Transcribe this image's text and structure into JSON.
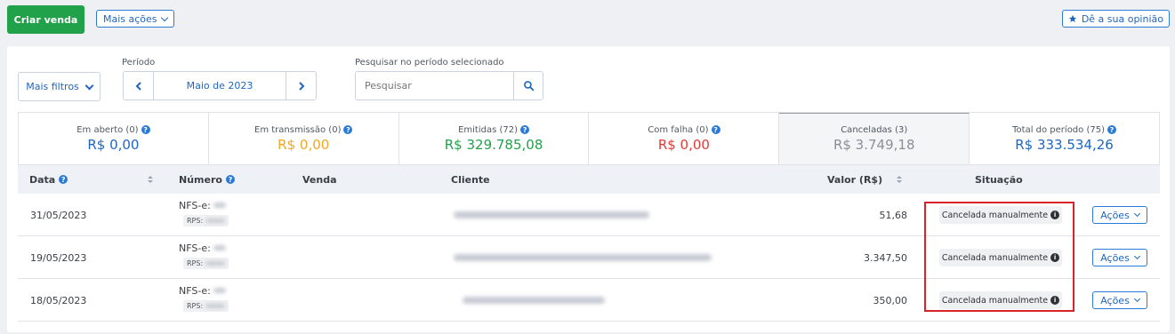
{
  "toolbar": {
    "create_sale": "Criar venda",
    "more_actions": "Mais ações",
    "feedback": "Dê a sua opinião"
  },
  "filters": {
    "more_filters": "Mais filtros",
    "period_label": "Período",
    "period_value": "Maio de 2023",
    "search_label": "Pesquisar no período selecionado",
    "search_placeholder": "Pesquisar"
  },
  "stats": [
    {
      "label": "Em aberto (0)",
      "value": "R$ 0,00",
      "color": "#1f66c1"
    },
    {
      "label": "Em transmissão (0)",
      "value": "R$ 0,00",
      "color": "#f5a623"
    },
    {
      "label": "Emitidas (72)",
      "value": "R$ 329.785,08",
      "color": "#21a24a"
    },
    {
      "label": "Com falha (0)",
      "value": "R$ 0,00",
      "color": "#e53935"
    },
    {
      "label": "Canceladas (3)",
      "value": "R$ 3.749,18",
      "color": "#8a9099"
    },
    {
      "label": "Total do período (75)",
      "value": "R$ 333.534,26",
      "color": "#1f66c1"
    }
  ],
  "table": {
    "headers": {
      "data": "Data",
      "numero": "Número",
      "venda": "Venda",
      "cliente": "Cliente",
      "valor": "Valor (R$)",
      "situacao": "Situação"
    },
    "rows": [
      {
        "date": "31/05/2023",
        "nfs": "NFS-e:",
        "rps": "RPS:",
        "value": "51,68",
        "status": "Cancelada manualmente",
        "actions": "Ações"
      },
      {
        "date": "19/05/2023",
        "nfs": "NFS-e:",
        "rps": "RPS:",
        "value": "3.347,50",
        "status": "Cancelada manualmente",
        "actions": "Ações"
      },
      {
        "date": "18/05/2023",
        "nfs": "NFS-e:",
        "rps": "RPS:",
        "value": "350,00",
        "status": "Cancelada manualmente",
        "actions": "Ações"
      }
    ]
  },
  "icons": {
    "star": "star-icon",
    "question": "question-icon",
    "info": "info-icon",
    "search": "search-icon",
    "chevron": "chevron-down-icon"
  },
  "highlight_color": "#d9232b"
}
